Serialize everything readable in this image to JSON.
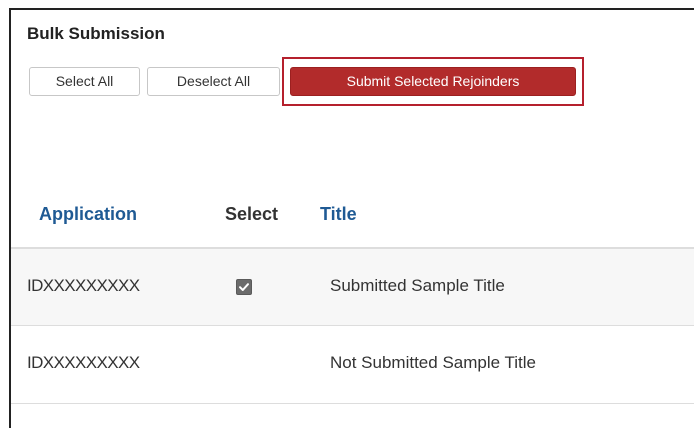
{
  "section": {
    "title": "Bulk Submission"
  },
  "toolbar": {
    "select_all_label": "Select All",
    "deselect_all_label": "Deselect All",
    "submit_label": "Submit Selected Rejoinders"
  },
  "table": {
    "columns": [
      "Application",
      "Select",
      "Title"
    ],
    "rows": [
      {
        "application": "IDXXXXXXXXX",
        "selected": true,
        "title": "Submitted Sample Title"
      },
      {
        "application": "IDXXXXXXXXX",
        "selected": false,
        "title": "Not Submitted Sample Title"
      }
    ]
  },
  "colors": {
    "primary_button": "#b22b2b",
    "highlight_outline": "#b5202d",
    "header_link": "#1f5a94",
    "checkbox_checked": "#6b6b6b"
  },
  "icons": {
    "checkbox": "checkmark-icon"
  }
}
